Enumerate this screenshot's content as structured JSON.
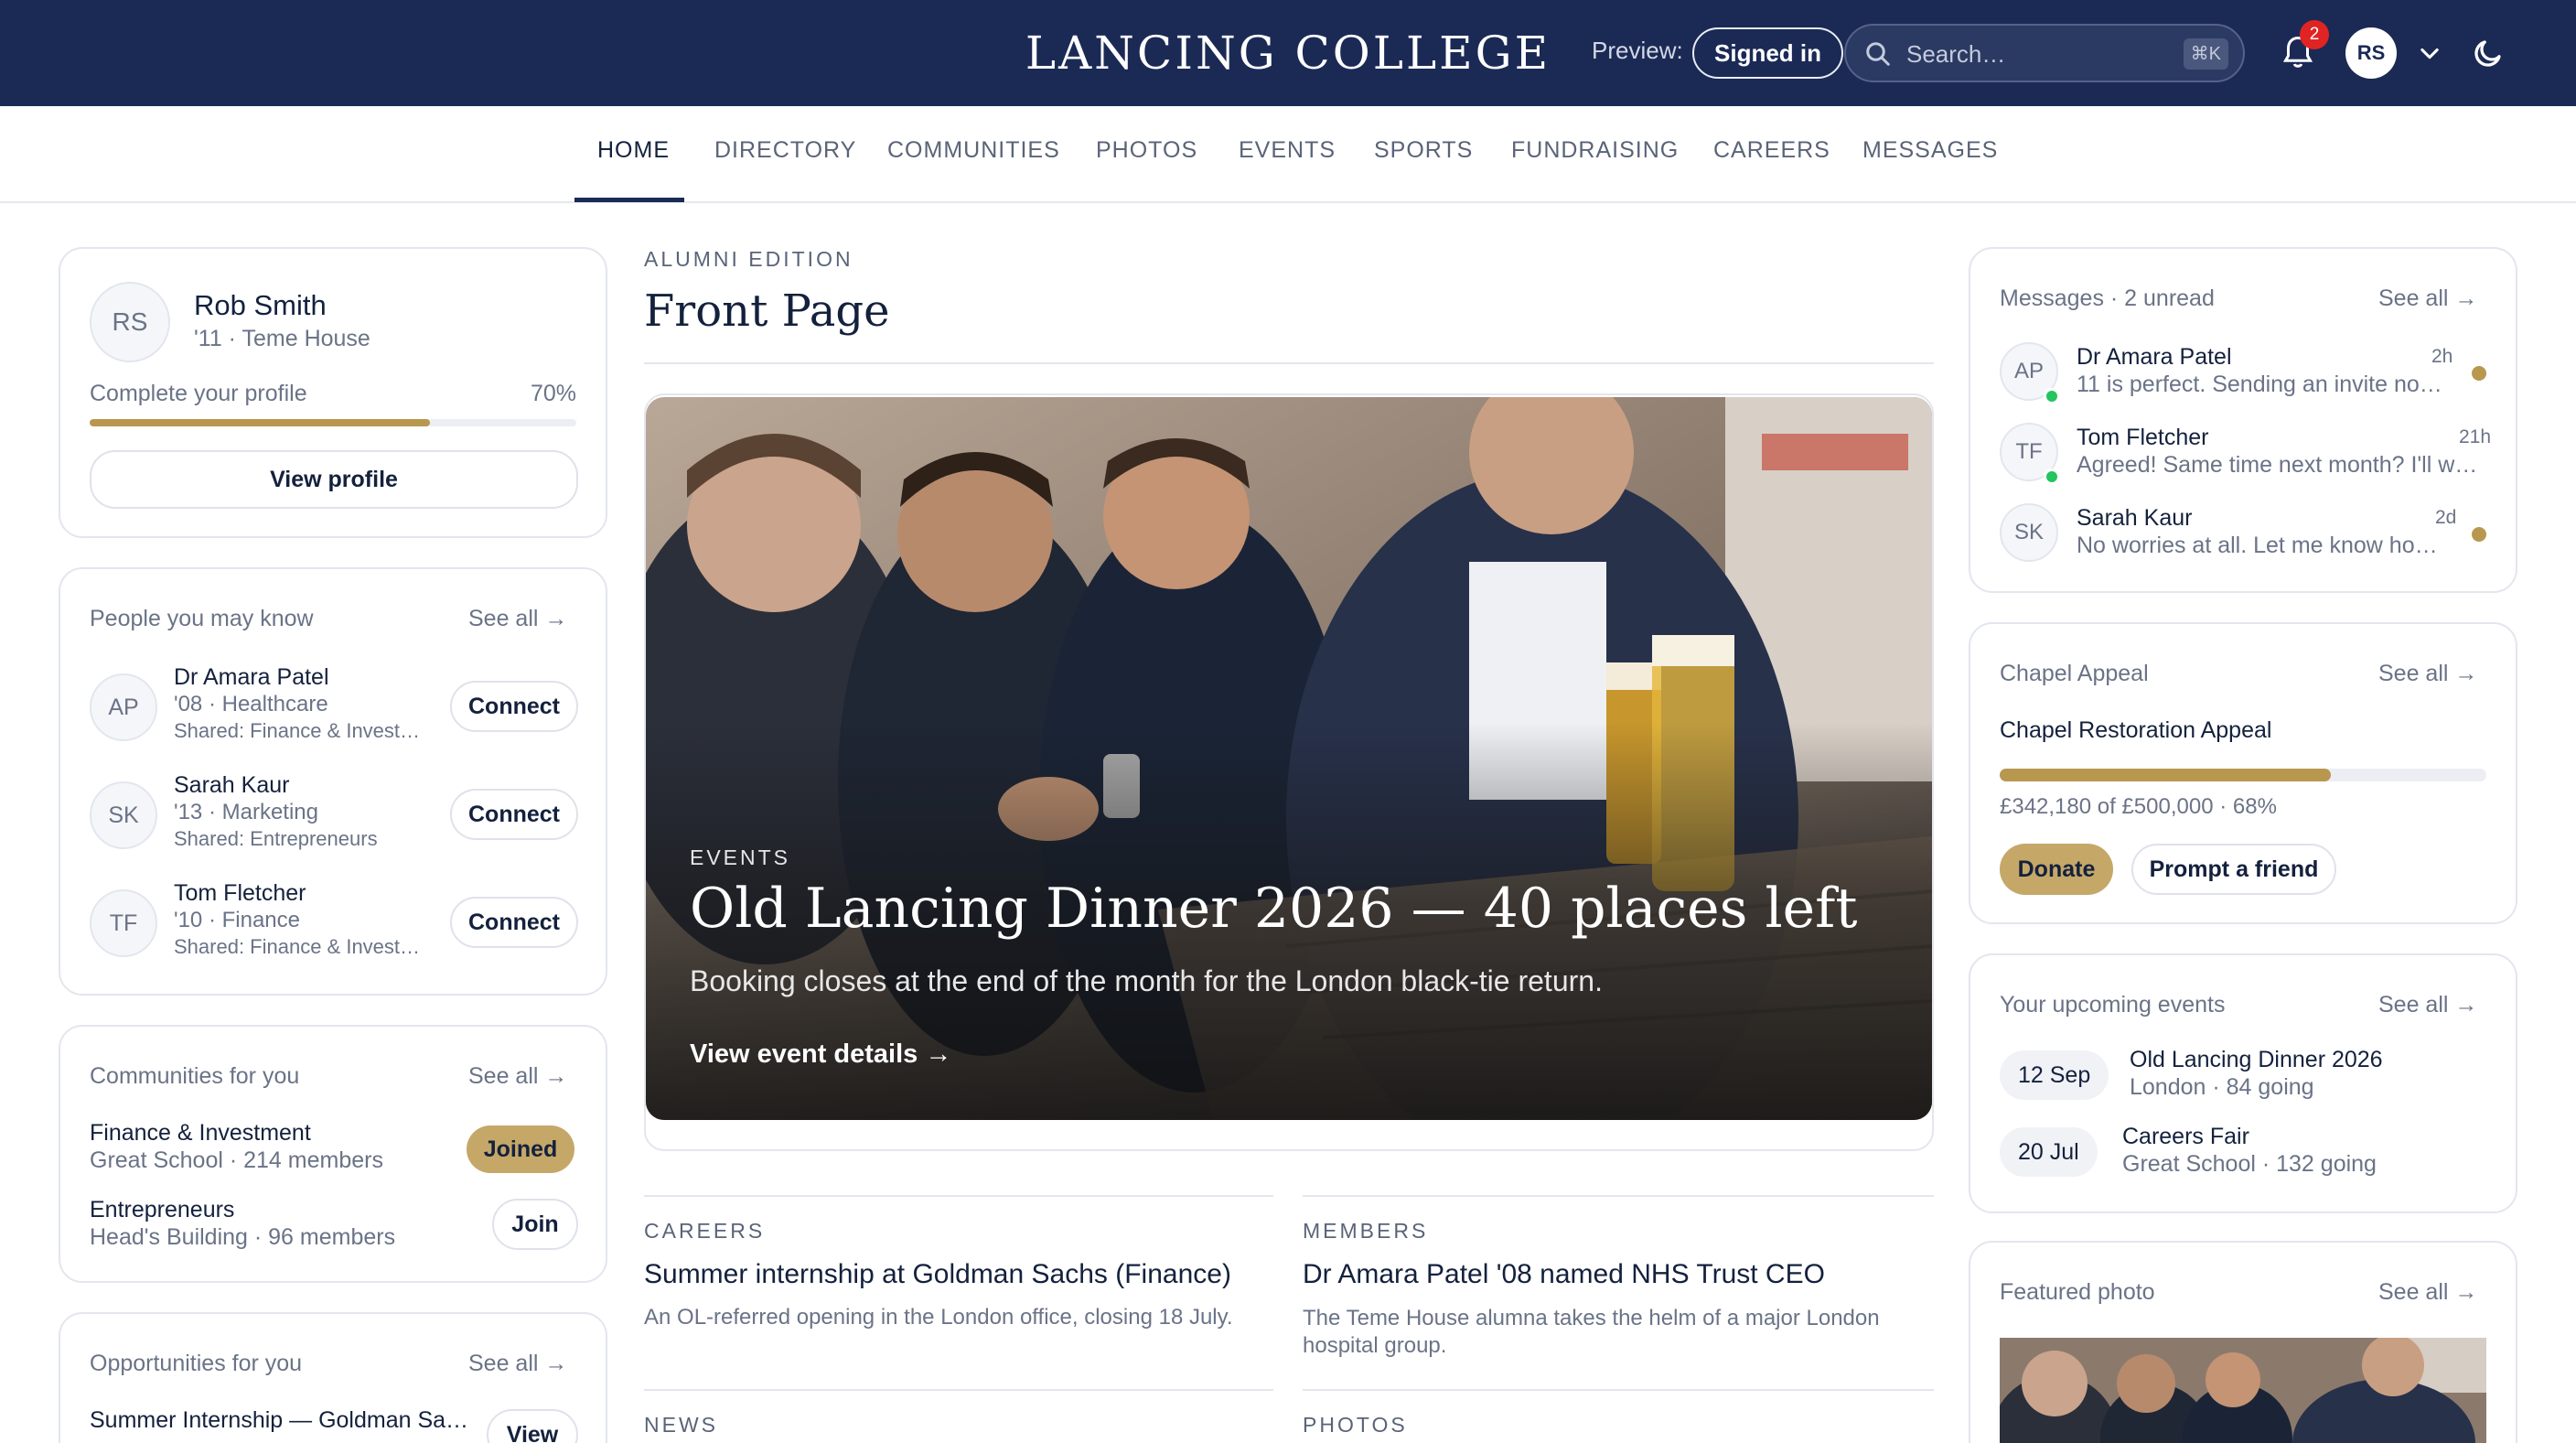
{
  "header": {
    "brand": "LANCING COLLEGE",
    "preview_label": "Preview:",
    "preview_state": "Signed in",
    "search_placeholder": "Search…",
    "search_shortcut": "⌘K",
    "notifications_count": "2",
    "user_initials": "RS"
  },
  "nav": {
    "items": [
      "HOME",
      "DIRECTORY",
      "COMMUNITIES",
      "PHOTOS",
      "EVENTS",
      "SPORTS",
      "FUNDRAISING",
      "CAREERS",
      "MESSAGES"
    ],
    "active": "HOME"
  },
  "profile": {
    "initials": "RS",
    "name": "Rob Smith",
    "meta": "'11 · Teme House",
    "complete_label": "Complete your profile",
    "complete_pct_label": "70%",
    "complete_fraction": 0.7,
    "button": "View profile"
  },
  "people": {
    "title": "People you may know",
    "see_all": "See all",
    "items": [
      {
        "initials": "AP",
        "name": "Dr Amara Patel",
        "meta": "'08 · Healthcare",
        "shared": "Shared: Finance & Invest…",
        "action": "Connect"
      },
      {
        "initials": "SK",
        "name": "Sarah Kaur",
        "meta": "'13 · Marketing",
        "shared": "Shared: Entrepreneurs",
        "action": "Connect"
      },
      {
        "initials": "TF",
        "name": "Tom Fletcher",
        "meta": "'10 · Finance",
        "shared": "Shared: Finance & Invest…",
        "action": "Connect"
      }
    ]
  },
  "communities": {
    "title": "Communities for you",
    "see_all": "See all",
    "items": [
      {
        "name": "Finance & Investment",
        "meta": "Great School · 214 members",
        "action": "Joined"
      },
      {
        "name": "Entrepreneurs",
        "meta": "Head's Building · 96 members",
        "action": "Join"
      }
    ]
  },
  "opportunities": {
    "title": "Opportunities for you",
    "see_all": "See all",
    "items": [
      {
        "name": "Summer Internship — Goldman Sa…",
        "action": "View"
      }
    ]
  },
  "main": {
    "kicker": "ALUMNI EDITION",
    "title": "Front Page",
    "hero": {
      "kicker": "EVENTS",
      "title": "Old Lancing Dinner 2026 — 40 places left",
      "desc": "Booking closes at the end of the month for the London black-tie return.",
      "cta": "View event details"
    },
    "stories": [
      {
        "kicker": "CAREERS",
        "title": "Summer internship at Goldman Sachs (Finance)",
        "desc": "An OL-referred opening in the London office, closing 18 July."
      },
      {
        "kicker": "MEMBERS",
        "title": "Dr Amara Patel '08 named NHS Trust CEO",
        "desc": "The Teme House alumna takes the helm of a major London hospital group."
      }
    ],
    "more_kickers": [
      "NEWS",
      "PHOTOS"
    ]
  },
  "messages": {
    "title": "Messages · 2 unread",
    "see_all": "See all",
    "items": [
      {
        "initials": "AP",
        "name": "Dr Amara Patel",
        "time": "2h",
        "preview": "11 is perfect. Sending an invite no…",
        "online": true,
        "unread": true
      },
      {
        "initials": "TF",
        "name": "Tom Fletcher",
        "time": "21h",
        "preview": "Agreed! Same time next month? I'll w…",
        "online": true,
        "unread": false
      },
      {
        "initials": "SK",
        "name": "Sarah Kaur",
        "time": "2d",
        "preview": "No worries at all. Let me know ho…",
        "online": false,
        "unread": true
      }
    ]
  },
  "appeal": {
    "title": "Chapel Appeal",
    "see_all": "See all",
    "name": "Chapel Restoration Appeal",
    "progress_fraction": 0.68,
    "raised": "£342,180 of £500,000 · 68%",
    "donate": "Donate",
    "prompt": "Prompt a friend"
  },
  "events": {
    "title": "Your upcoming events",
    "see_all": "See all",
    "items": [
      {
        "date": "12 Sep",
        "name": "Old Lancing Dinner 2026",
        "meta": "London · 84 going"
      },
      {
        "date": "20 Jul",
        "name": "Careers Fair",
        "meta": "Great School · 132 going"
      }
    ]
  },
  "photo": {
    "title": "Featured photo",
    "see_all": "See all"
  },
  "colors": {
    "navy": "#1b2a55",
    "gold": "#c5a768",
    "online": "#22c55e",
    "unread_dot": "#c5a768",
    "badge": "#e02424"
  }
}
